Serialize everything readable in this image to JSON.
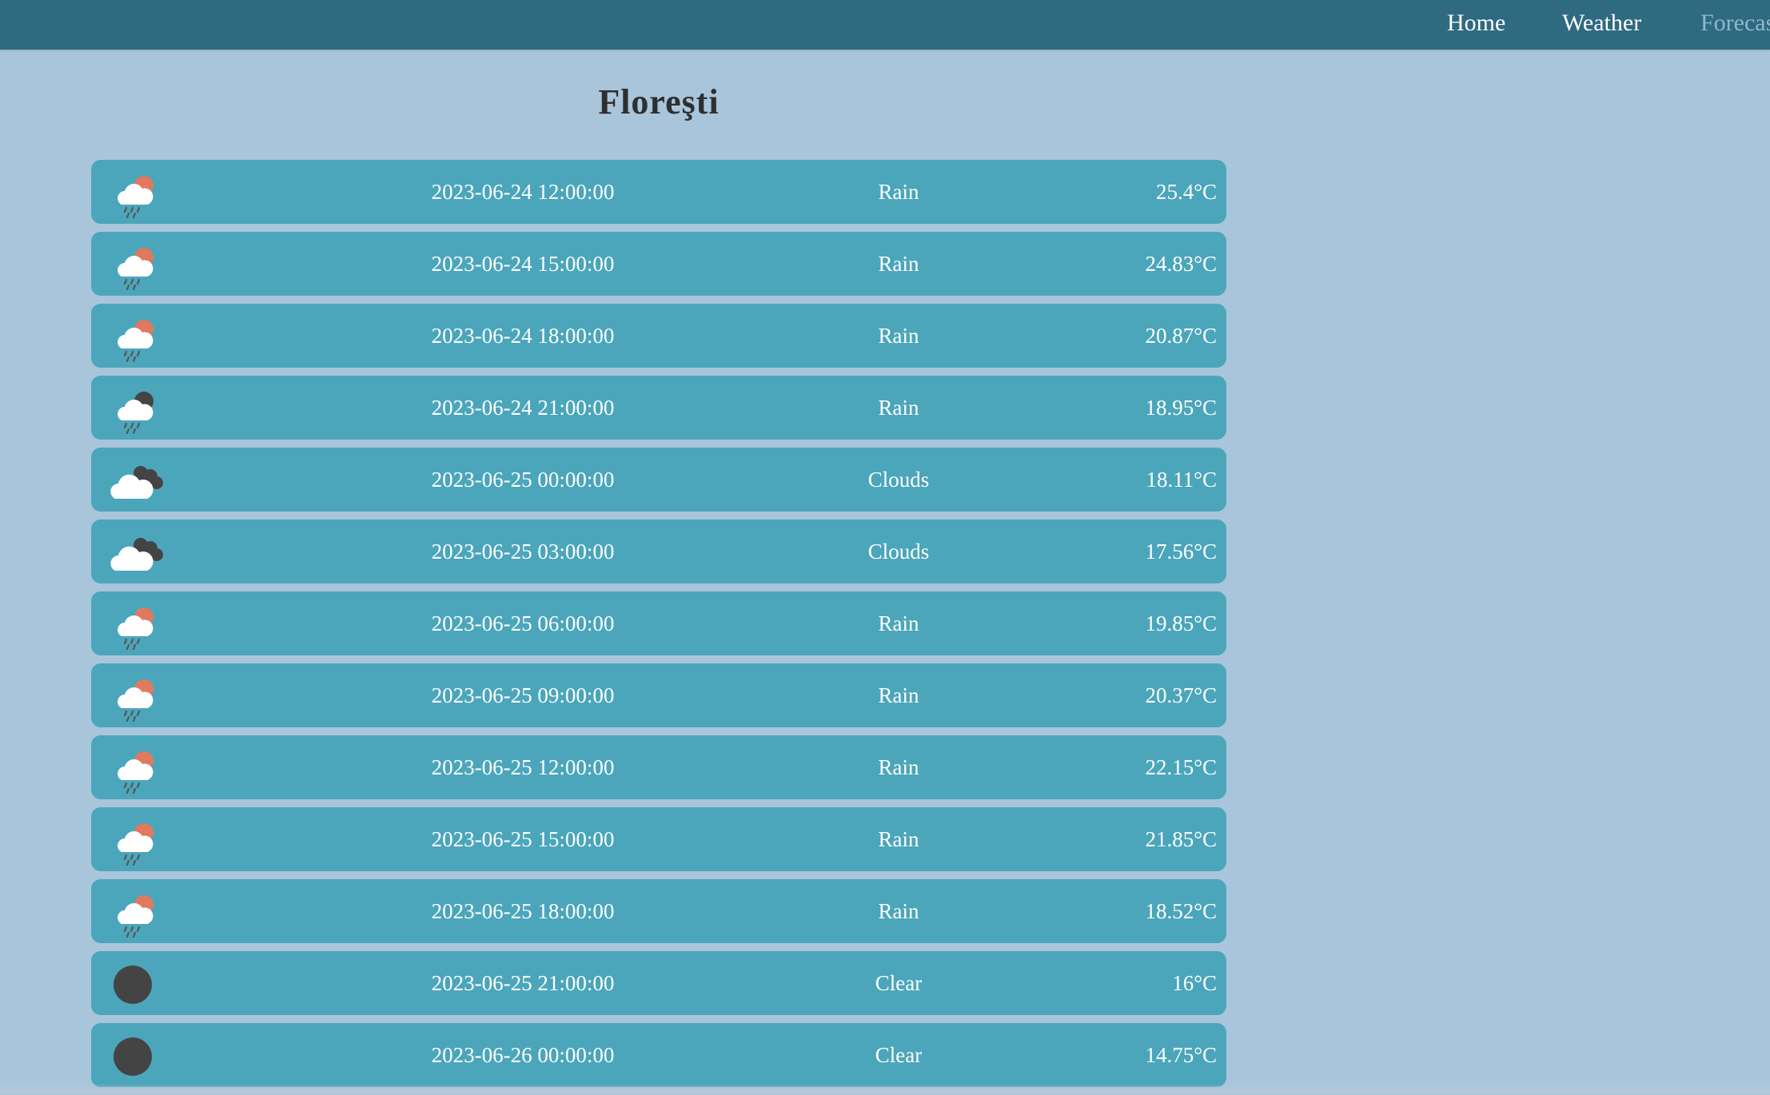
{
  "nav": {
    "home": "Home",
    "weather": "Weather",
    "forecast": "Forecast"
  },
  "city": "Floreşti",
  "colors": {
    "nav_bg": "#2e6a80",
    "page_bg": "#a9c5dc",
    "row_bg": "#4ba6bb",
    "sun": "#e07a5f",
    "moon": "#444444"
  },
  "forecast": [
    {
      "datetime": "2023-06-24 12:00:00",
      "condition": "Rain",
      "temp": "25.4°C",
      "icon": "rain-day-icon"
    },
    {
      "datetime": "2023-06-24 15:00:00",
      "condition": "Rain",
      "temp": "24.83°C",
      "icon": "rain-day-icon"
    },
    {
      "datetime": "2023-06-24 18:00:00",
      "condition": "Rain",
      "temp": "20.87°C",
      "icon": "rain-day-icon"
    },
    {
      "datetime": "2023-06-24 21:00:00",
      "condition": "Rain",
      "temp": "18.95°C",
      "icon": "rain-night-icon"
    },
    {
      "datetime": "2023-06-25 00:00:00",
      "condition": "Clouds",
      "temp": "18.11°C",
      "icon": "clouds-icon"
    },
    {
      "datetime": "2023-06-25 03:00:00",
      "condition": "Clouds",
      "temp": "17.56°C",
      "icon": "clouds-icon"
    },
    {
      "datetime": "2023-06-25 06:00:00",
      "condition": "Rain",
      "temp": "19.85°C",
      "icon": "rain-day-icon"
    },
    {
      "datetime": "2023-06-25 09:00:00",
      "condition": "Rain",
      "temp": "20.37°C",
      "icon": "rain-day-icon"
    },
    {
      "datetime": "2023-06-25 12:00:00",
      "condition": "Rain",
      "temp": "22.15°C",
      "icon": "rain-day-icon"
    },
    {
      "datetime": "2023-06-25 15:00:00",
      "condition": "Rain",
      "temp": "21.85°C",
      "icon": "rain-day-icon"
    },
    {
      "datetime": "2023-06-25 18:00:00",
      "condition": "Rain",
      "temp": "18.52°C",
      "icon": "rain-day-icon"
    },
    {
      "datetime": "2023-06-25 21:00:00",
      "condition": "Clear",
      "temp": "16°C",
      "icon": "clear-night-icon"
    },
    {
      "datetime": "2023-06-26 00:00:00",
      "condition": "Clear",
      "temp": "14.75°C",
      "icon": "clear-night-icon"
    }
  ]
}
